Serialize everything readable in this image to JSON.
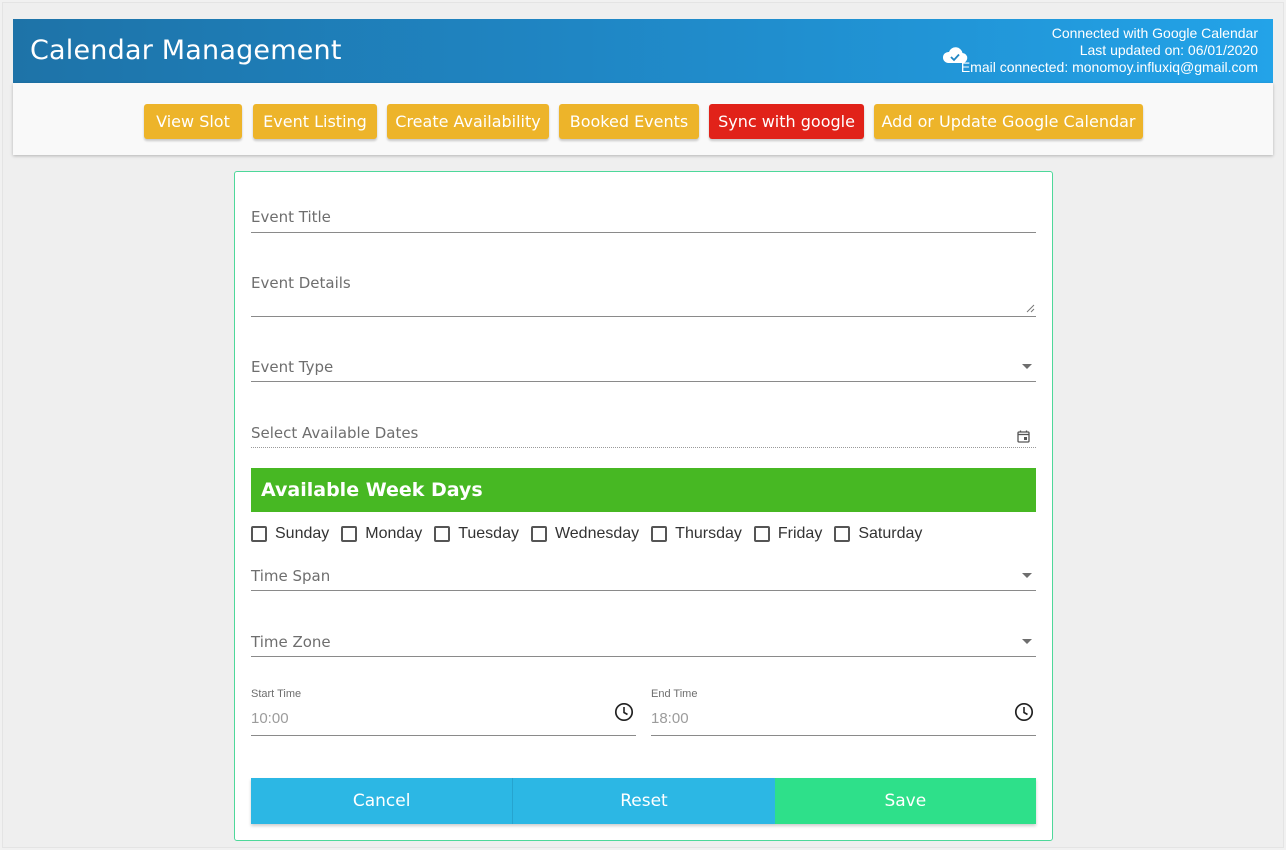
{
  "header": {
    "title": "Calendar Management",
    "status_line1": "Connected with Google Calendar",
    "status_line2": "Last updated on: 06/01/2020",
    "status_line3": "Email connected: monomoy.influxiq@gmail.com",
    "icon": "cloud-check-icon"
  },
  "toolbar": {
    "buttons": [
      {
        "label": "View Slot"
      },
      {
        "label": "Event Listing"
      },
      {
        "label": "Create Availability"
      },
      {
        "label": "Booked Events"
      },
      {
        "label": "Sync with google"
      },
      {
        "label": "Add or Update Google Calendar"
      }
    ]
  },
  "form": {
    "event_title": {
      "label": "Event Title",
      "value": ""
    },
    "event_details": {
      "label": "Event Details",
      "value": ""
    },
    "event_type": {
      "label": "Event Type",
      "value": ""
    },
    "available_dates": {
      "label": "Select Available Dates",
      "value": ""
    },
    "week_days_heading": "Available Week Days",
    "week_days": [
      {
        "label": "Sunday",
        "checked": false
      },
      {
        "label": "Monday",
        "checked": false
      },
      {
        "label": "Tuesday",
        "checked": false
      },
      {
        "label": "Wednesday",
        "checked": false
      },
      {
        "label": "Thursday",
        "checked": false
      },
      {
        "label": "Friday",
        "checked": false
      },
      {
        "label": "Saturday",
        "checked": false
      }
    ],
    "time_span": {
      "label": "Time Span",
      "value": ""
    },
    "time_zone": {
      "label": "Time Zone",
      "value": ""
    },
    "start_time": {
      "label": "Start Time",
      "placeholder": "10:00"
    },
    "end_time": {
      "label": "End Time",
      "placeholder": "18:00"
    }
  },
  "actions": {
    "cancel": "Cancel",
    "reset": "Reset",
    "save": "Save"
  },
  "colors": {
    "header_start": "#1e73a8",
    "header_end": "#23a3e8",
    "toolbar_button": "#edb42a",
    "sync_button": "#e12219",
    "week_header": "#47b823",
    "cancel_reset": "#2cb7e4",
    "save": "#2ee08a",
    "card_border": "#4ed89a"
  }
}
